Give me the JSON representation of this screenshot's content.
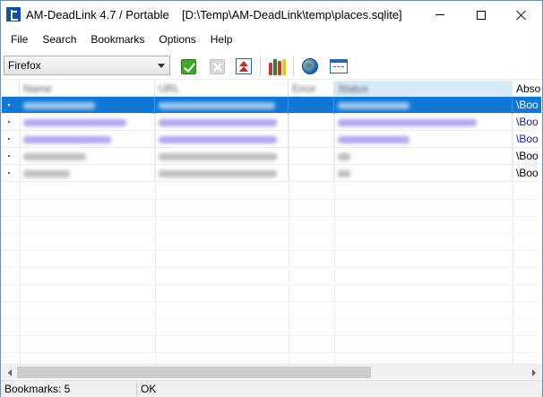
{
  "window": {
    "app_title": "AM-DeadLink 4.7 / Portable",
    "file_path": "[D:\\Temp\\AM-DeadLink\\temp\\places.sqlite]"
  },
  "menu": [
    "File",
    "Search",
    "Bookmarks",
    "Options",
    "Help"
  ],
  "toolbar": {
    "browser_selected": "Firefox",
    "icons": [
      "check-icon",
      "delete-icon",
      "move-top-icon",
      "books-icon",
      "globe-icon",
      "window-icon"
    ]
  },
  "grid": {
    "columns": [
      {
        "label": "Name",
        "blurred": true
      },
      {
        "label": "URL",
        "blurred": true
      },
      {
        "label": "Error",
        "blurred": true
      },
      {
        "label": "Status",
        "blurred": true
      },
      {
        "label": "Absol",
        "blurred": false
      }
    ],
    "rows": [
      {
        "selected": true,
        "abs": "\\Boo",
        "color": "#0f78d7"
      },
      {
        "selected": false,
        "abs": "\\Boo",
        "color": "#7a5fe0"
      },
      {
        "selected": false,
        "abs": "\\Boo",
        "color": "#7a5fe0"
      },
      {
        "selected": false,
        "abs": "\\Boo",
        "color": "#555555"
      },
      {
        "selected": false,
        "abs": "\\Boo",
        "color": "#555555"
      }
    ]
  },
  "status": {
    "bookmarks": "Bookmarks: 5",
    "state": "OK"
  },
  "colors": {
    "selection": "#0f78d7",
    "link_blue": "#1a1aa6",
    "border": "#6f8fb8"
  }
}
